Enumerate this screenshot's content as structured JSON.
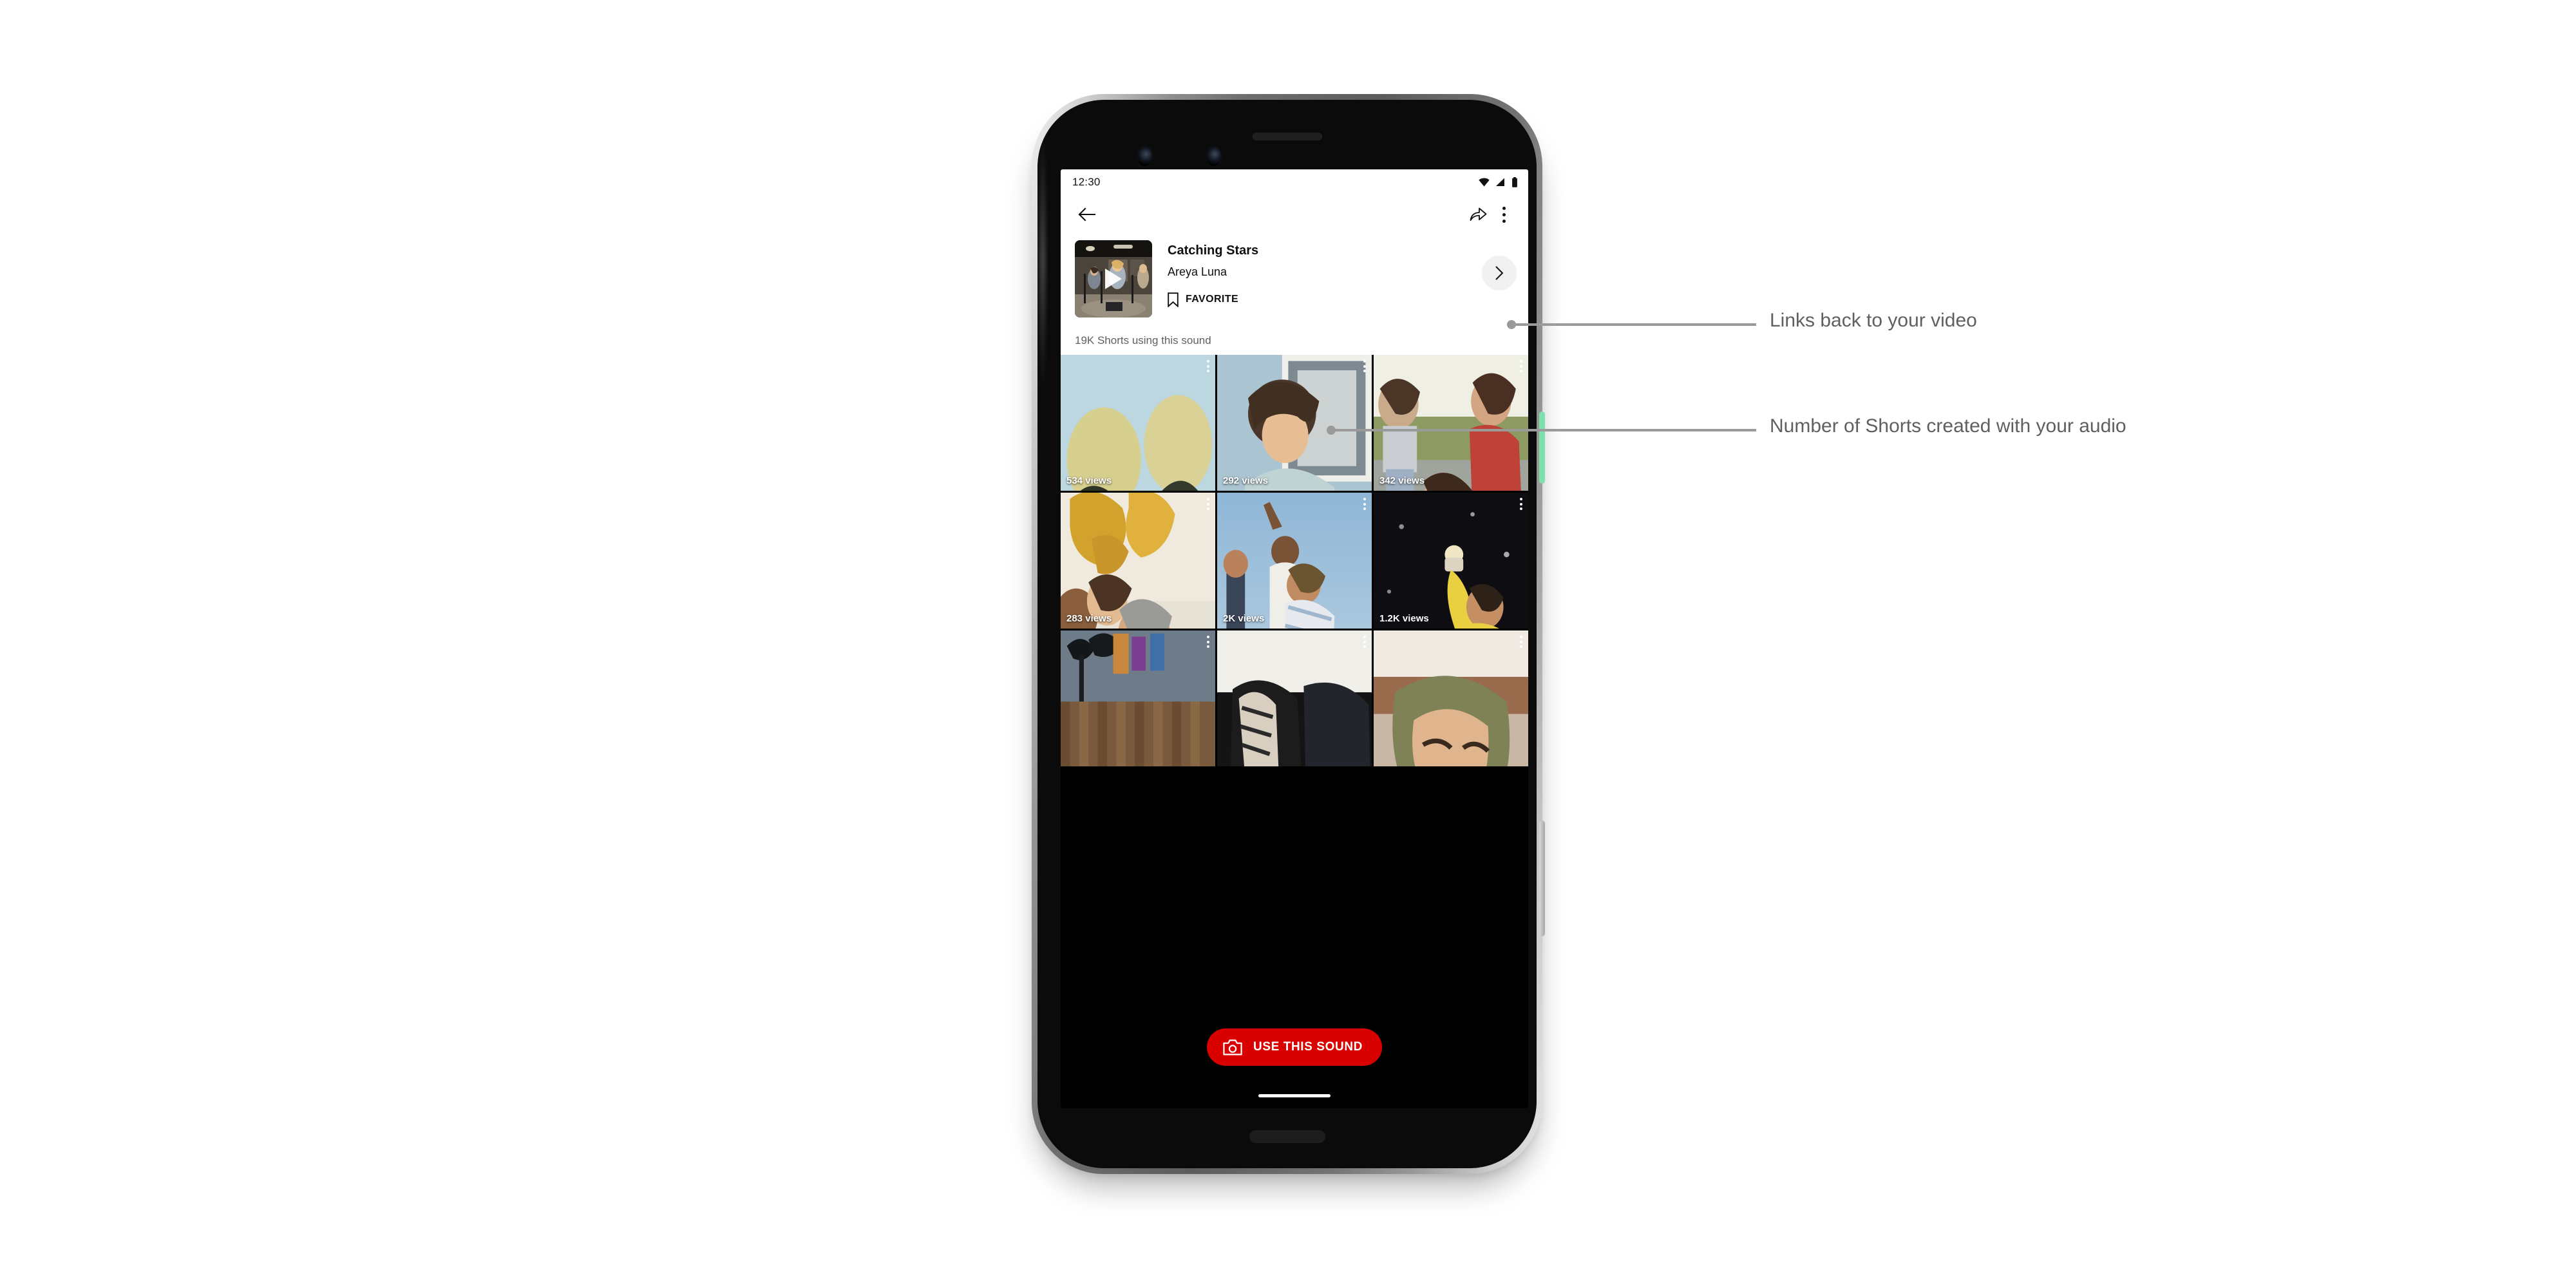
{
  "device": {
    "name": "android-phone-mockup"
  },
  "status_bar": {
    "time": "12:30",
    "icons": [
      "wifi-icon",
      "cellular-signal-icon",
      "battery-icon"
    ]
  },
  "app_bar": {
    "back_icon": "back-arrow-icon",
    "share_icon": "share-icon",
    "overflow_icon": "more-vertical-icon"
  },
  "sound": {
    "title": "Catching Stars",
    "artist": "Areya Luna",
    "favorite_label": "FAVORITE",
    "favorite_icon": "bookmark-icon",
    "play_icon": "play-icon",
    "chevron_icon": "chevron-right-icon",
    "shorts_count": "19K Shorts using this sound"
  },
  "grid": {
    "items": [
      {
        "views": "534 views",
        "art": "rollercoaster-friends"
      },
      {
        "views": "292 views",
        "art": "guitar-player"
      },
      {
        "views": "342 views",
        "art": "skateboard-friends"
      },
      {
        "views": "283 views",
        "art": "birthday-party"
      },
      {
        "views": "2K views",
        "art": "beach-jump"
      },
      {
        "views": "1.2K views",
        "art": "night-celebration"
      },
      {
        "views": "",
        "art": "palm-trees-fence"
      },
      {
        "views": "",
        "art": "dark-jacket"
      },
      {
        "views": "",
        "art": "hooded-smile"
      }
    ]
  },
  "cta": {
    "label": "USE THIS SOUND",
    "icon": "camera-icon",
    "color": "#d90000"
  },
  "annotations": [
    {
      "text": "Links back to your video"
    },
    {
      "text": "Number of Shorts created with your audio"
    }
  ],
  "colors": {
    "accent_red": "#d90000",
    "power_button_green": "#7ee0ad",
    "annotation_gray": "#9a9a9a",
    "label_text": "#5f5f5f"
  }
}
